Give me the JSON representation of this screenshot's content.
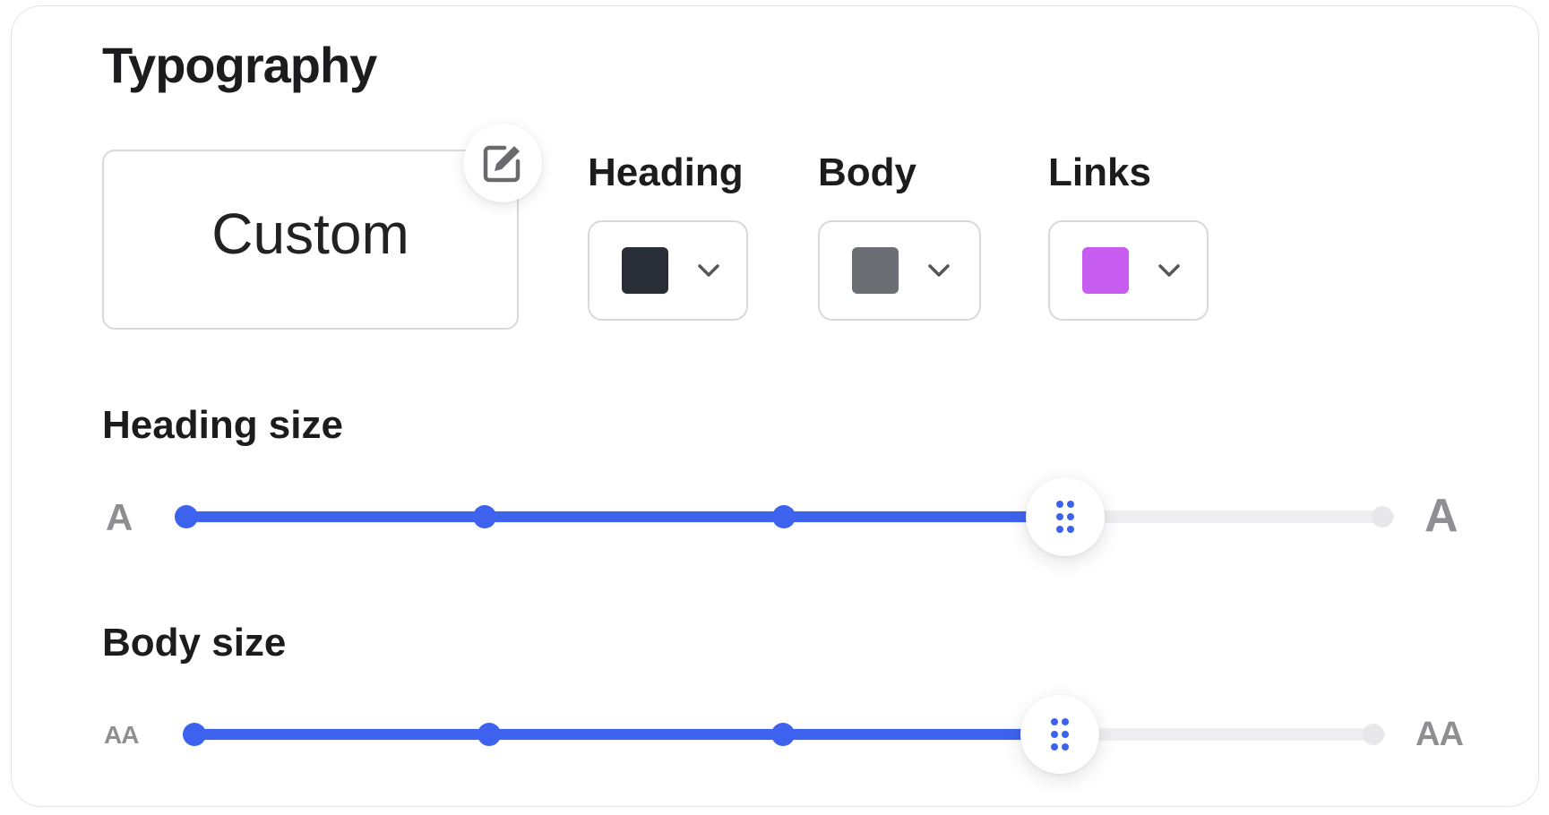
{
  "panel": {
    "title": "Typography",
    "preset": {
      "name": "Custom",
      "edit_icon": "edit-icon"
    },
    "colors": [
      {
        "label": "Heading",
        "swatch": "#2a2e36"
      },
      {
        "label": "Body",
        "swatch": "#6b6e73"
      },
      {
        "label": "Links",
        "swatch": "#c65cf0"
      }
    ],
    "heading_size": {
      "label": "Heading size",
      "min_label": "A",
      "max_label": "A",
      "steps": 5,
      "selected_index": 3
    },
    "body_size": {
      "label": "Body size",
      "min_label": "AA",
      "max_label": "AA",
      "steps": 5,
      "selected_index": 3
    }
  },
  "colors": {
    "accent": "#3d63ee",
    "border": "#d9d9dc",
    "track": "#efeff1",
    "muted": "#8e8e93"
  }
}
